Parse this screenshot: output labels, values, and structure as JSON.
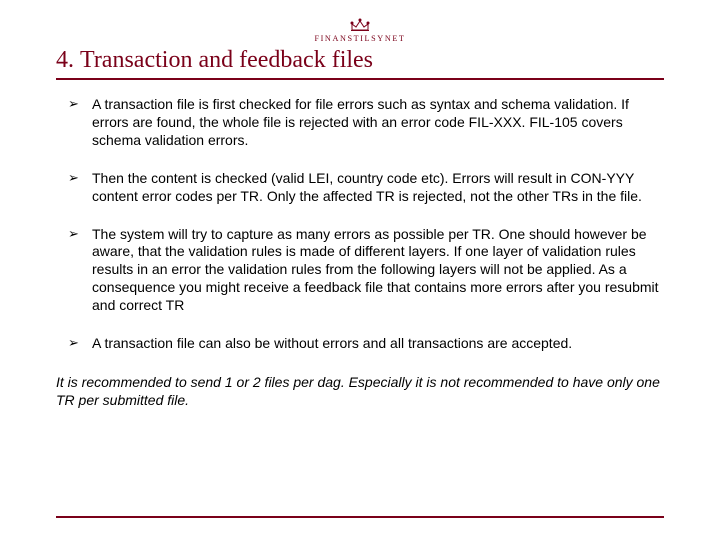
{
  "logo": {
    "org_name": "FINANSTILSYNET"
  },
  "heading": {
    "number": "4.",
    "text": "Transaction and feedback files"
  },
  "bullets": [
    "A transaction file is first checked for file errors such as syntax and schema validation. If errors are found, the whole file is rejected with an error code FIL-XXX. FIL-105 covers schema validation errors.",
    "Then the content is checked (valid LEI, country code etc). Errors will result in CON-YYY content error codes per TR. Only the affected TR is rejected, not the other TRs in the file.",
    "The system will try to capture as many errors as possible per TR. One should however be aware, that the validation rules is made of different layers. If one layer of validation rules results in an error the validation rules from the following layers will not be applied. As a consequence you might receive a feedback file that contains more errors after you resubmit and correct TR",
    "A transaction file can also be without errors and all transactions are accepted."
  ],
  "recommendation": "It is recommended to send 1 or 2 files per dag. Especially it is not recommended to have only one TR per submitted file."
}
